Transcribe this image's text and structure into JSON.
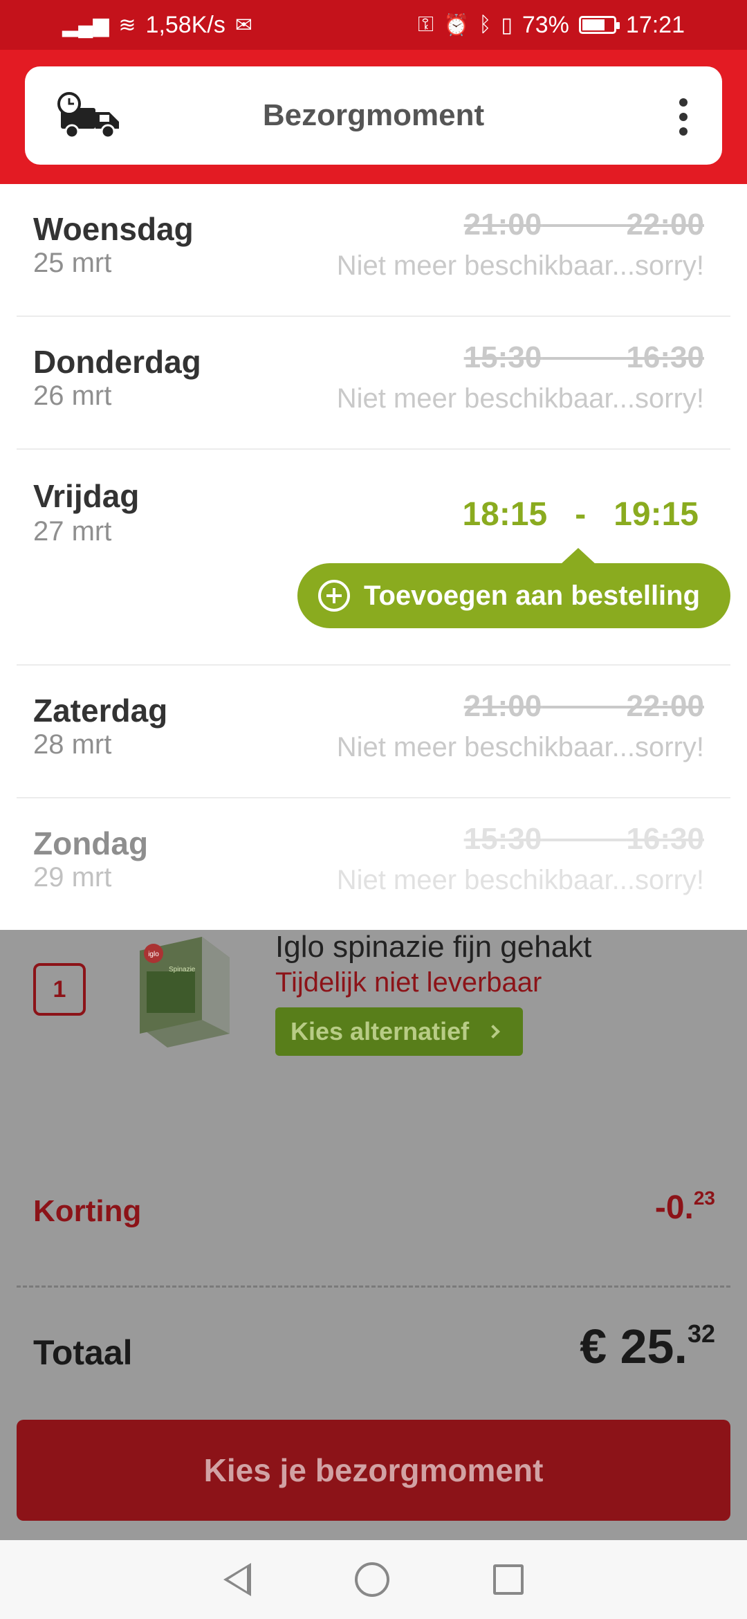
{
  "status_bar": {
    "speed": "1,58K/s",
    "battery": "73%",
    "battery_level": 0.73,
    "time": "17:21"
  },
  "header": {
    "title": "Bezorgmoment"
  },
  "slots": [
    {
      "day": "Woensdag",
      "date": "25 mrt",
      "time_start": "21:00",
      "time_end": "22:00",
      "available": false,
      "status": "Niet meer beschikbaar...sorry!"
    },
    {
      "day": "Donderdag",
      "date": "26 mrt",
      "time_start": "15:30",
      "time_end": "16:30",
      "available": false,
      "status": "Niet meer beschikbaar...sorry!"
    },
    {
      "day": "Vrijdag",
      "date": "27 mrt",
      "time_start": "18:15",
      "time_end": "19:15",
      "available": true,
      "button": "Toevoegen aan bestelling"
    },
    {
      "day": "Zaterdag",
      "date": "28 mrt",
      "time_start": "21:00",
      "time_end": "22:00",
      "available": false,
      "status": "Niet meer beschikbaar...sorry!"
    },
    {
      "day": "Zondag",
      "date": "29 mrt",
      "time_start": "15:30",
      "time_end": "16:30",
      "available": false,
      "status": "Niet meer beschikbaar...sorry!"
    }
  ],
  "cart_item": {
    "quantity": "1",
    "name": "Iglo spinazie fijn gehakt",
    "status": "Tijdelijk niet leverbaar",
    "alt_button": "Kies alternatief",
    "brand": "iglo",
    "package_label": "Spinazie"
  },
  "totals": {
    "discount_label": "Korting",
    "discount_main": "-0.",
    "discount_cents": "23",
    "total_label": "Totaal",
    "total_main": "€ 25.",
    "total_cents": "32"
  },
  "cta": {
    "label": "Kies je bezorgmoment"
  },
  "colors": {
    "brand_red": "#e31b23",
    "status_red": "#c4121b",
    "available_green": "#8aab1f"
  }
}
